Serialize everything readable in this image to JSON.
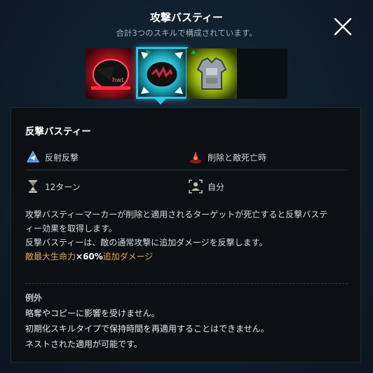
{
  "header": {
    "title": "攻撃バスティー",
    "subtitle": "合計3つのスキルで構成されています。"
  },
  "skills": [
    {
      "name": "skill-slot-1",
      "icon": "red-mask-icon"
    },
    {
      "name": "skill-slot-2",
      "icon": "cyan-shield-icon",
      "selected": true
    },
    {
      "name": "skill-slot-3",
      "icon": "armor-icon"
    },
    {
      "name": "skill-slot-4",
      "icon": "empty-slot"
    }
  ],
  "detail": {
    "skill_name": "反撃バスティー",
    "stats": {
      "type": "反射反撃",
      "trigger": "削除と敵死亡時",
      "duration": "12ターン",
      "target": "自分"
    },
    "description": {
      "line1": "攻撃バスティーマーカーが削除と適用されるターゲットが死亡すると反撃バステ",
      "line2": "ィー効果を取得します。",
      "line3": "反撃バスティーは、敵の通常攻撃に追加ダメージを反撃します。",
      "highlight_pre": "敵最大生命力",
      "highlight_mid": "×60%",
      "highlight_post": "追加ダメージ"
    },
    "exceptions": {
      "title": "例外",
      "items": [
        "略奪やコピーに影響を受けません。",
        "初期化スキルタイプで保持時間を再適用することはできません。",
        "ネストされた適用が可能です。"
      ]
    }
  },
  "colors": {
    "accent": "#2ec4e8",
    "highlight": "#e4a35a",
    "panel_bg": "#0c1014",
    "page_bg": "#0f1d2b"
  }
}
